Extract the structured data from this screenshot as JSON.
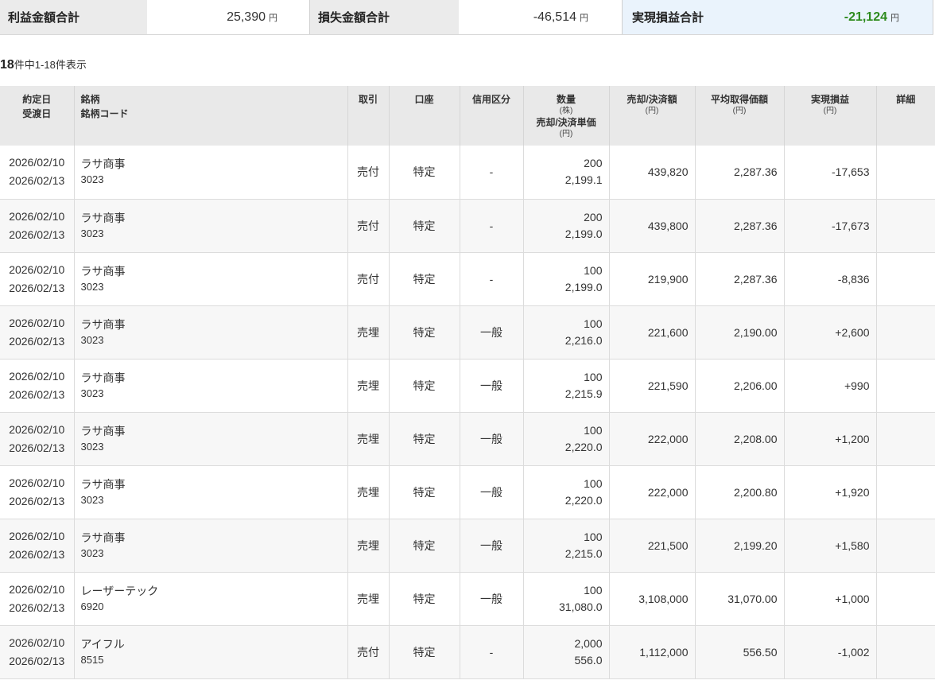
{
  "summary": {
    "profit_label": "利益金額合計",
    "profit_value": "25,390",
    "loss_label": "損失金額合計",
    "loss_value": "-46,514",
    "realized_label": "実現損益合計",
    "realized_value": "-21,124",
    "unit": "円"
  },
  "count": {
    "total": "18",
    "text": "件中1-18件表示"
  },
  "headers": {
    "date1": "約定日",
    "date2": "受渡日",
    "name1": "銘柄",
    "name2": "銘柄コード",
    "trade": "取引",
    "account": "口座",
    "margin": "信用区分",
    "qty": "数量",
    "qty_unit": "(株)",
    "price": "売却/決済単価",
    "price_unit": "(円)",
    "amount": "売却/決済額",
    "amount_unit": "(円)",
    "avg": "平均取得価額",
    "avg_unit": "(円)",
    "pl": "実現損益",
    "pl_unit": "(円)",
    "detail": "詳細"
  },
  "colors": {
    "loss": "#2c8a1c",
    "gain": "#e0115f",
    "header_bg": "#e9e9e9"
  },
  "rows": [
    {
      "trade_date": "2026/02/10",
      "settle_date": "2026/02/13",
      "name": "ラサ商事",
      "code": "3023",
      "trade": "売付",
      "account": "特定",
      "margin": "-",
      "qty": "200",
      "price": "2,199.1",
      "amount": "439,820",
      "avg": "2,287.36",
      "pl": "-17,653",
      "pl_sign": "neg"
    },
    {
      "trade_date": "2026/02/10",
      "settle_date": "2026/02/13",
      "name": "ラサ商事",
      "code": "3023",
      "trade": "売付",
      "account": "特定",
      "margin": "-",
      "qty": "200",
      "price": "2,199.0",
      "amount": "439,800",
      "avg": "2,287.36",
      "pl": "-17,673",
      "pl_sign": "neg"
    },
    {
      "trade_date": "2026/02/10",
      "settle_date": "2026/02/13",
      "name": "ラサ商事",
      "code": "3023",
      "trade": "売付",
      "account": "特定",
      "margin": "-",
      "qty": "100",
      "price": "2,199.0",
      "amount": "219,900",
      "avg": "2,287.36",
      "pl": "-8,836",
      "pl_sign": "neg"
    },
    {
      "trade_date": "2026/02/10",
      "settle_date": "2026/02/13",
      "name": "ラサ商事",
      "code": "3023",
      "trade": "売埋",
      "account": "特定",
      "margin": "一般",
      "qty": "100",
      "price": "2,216.0",
      "amount": "221,600",
      "avg": "2,190.00",
      "pl": "+2,600",
      "pl_sign": "pos"
    },
    {
      "trade_date": "2026/02/10",
      "settle_date": "2026/02/13",
      "name": "ラサ商事",
      "code": "3023",
      "trade": "売埋",
      "account": "特定",
      "margin": "一般",
      "qty": "100",
      "price": "2,215.9",
      "amount": "221,590",
      "avg": "2,206.00",
      "pl": "+990",
      "pl_sign": "pos"
    },
    {
      "trade_date": "2026/02/10",
      "settle_date": "2026/02/13",
      "name": "ラサ商事",
      "code": "3023",
      "trade": "売埋",
      "account": "特定",
      "margin": "一般",
      "qty": "100",
      "price": "2,220.0",
      "amount": "222,000",
      "avg": "2,208.00",
      "pl": "+1,200",
      "pl_sign": "pos"
    },
    {
      "trade_date": "2026/02/10",
      "settle_date": "2026/02/13",
      "name": "ラサ商事",
      "code": "3023",
      "trade": "売埋",
      "account": "特定",
      "margin": "一般",
      "qty": "100",
      "price": "2,220.0",
      "amount": "222,000",
      "avg": "2,200.80",
      "pl": "+1,920",
      "pl_sign": "pos"
    },
    {
      "trade_date": "2026/02/10",
      "settle_date": "2026/02/13",
      "name": "ラサ商事",
      "code": "3023",
      "trade": "売埋",
      "account": "特定",
      "margin": "一般",
      "qty": "100",
      "price": "2,215.0",
      "amount": "221,500",
      "avg": "2,199.20",
      "pl": "+1,580",
      "pl_sign": "pos"
    },
    {
      "trade_date": "2026/02/10",
      "settle_date": "2026/02/13",
      "name": "レーザーテック",
      "code": "6920",
      "trade": "売埋",
      "account": "特定",
      "margin": "一般",
      "qty": "100",
      "price": "31,080.0",
      "amount": "3,108,000",
      "avg": "31,070.00",
      "pl": "+1,000",
      "pl_sign": "pos"
    },
    {
      "trade_date": "2026/02/10",
      "settle_date": "2026/02/13",
      "name": "アイフル",
      "code": "8515",
      "trade": "売付",
      "account": "特定",
      "margin": "-",
      "qty": "2,000",
      "price": "556.0",
      "amount": "1,112,000",
      "avg": "556.50",
      "pl": "-1,002",
      "pl_sign": "neg"
    }
  ]
}
